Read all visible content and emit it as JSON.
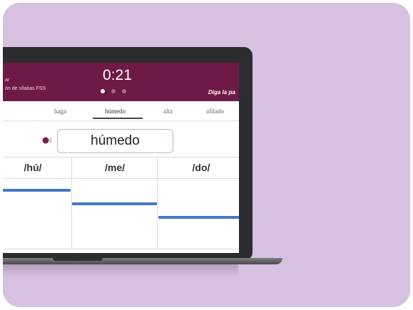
{
  "topbar": {
    "line1": "ar",
    "line2": "ón de sílabas  FSS",
    "timer": "0:21",
    "hint": "Diga la pa",
    "dots_total": 3,
    "dots_active_index": 0
  },
  "tabs": [
    "haga",
    "húmedo",
    "alta",
    "afilado"
  ],
  "active_tab": "húmedo",
  "word": "húmedo",
  "syllables": [
    "/hú/",
    "/me/",
    "/do/"
  ],
  "colors": {
    "background": "#d6c1e0",
    "topbar": "#6e1a45",
    "pitch_line": "#4477c4",
    "speaker_icon": "#7a1f4f"
  }
}
